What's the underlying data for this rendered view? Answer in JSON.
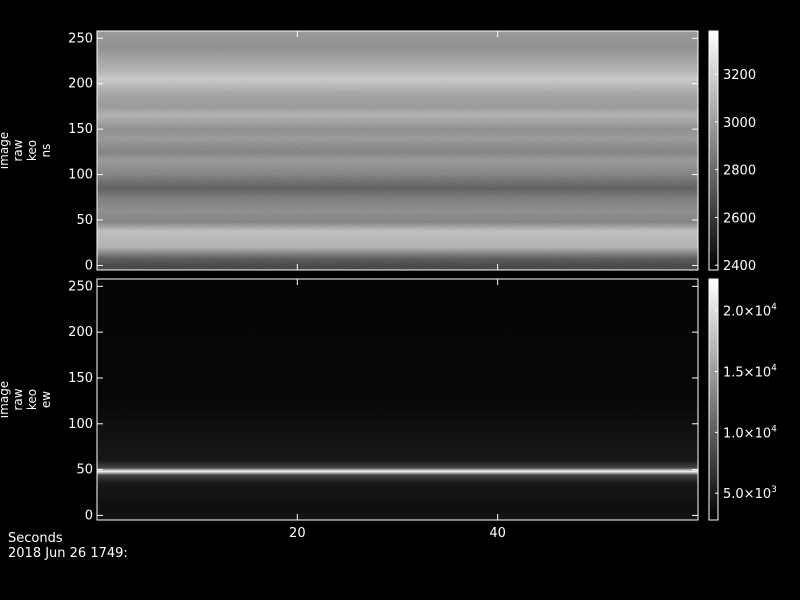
{
  "colors": {
    "background": "#000000",
    "foreground": "#ffffff"
  },
  "footer": {
    "xaxis_caption": "Seconds",
    "timestamp": "2018 Jun 26 1749:"
  },
  "chart_data": [
    {
      "type": "heatmap",
      "panel": "top",
      "ylabel_lines": [
        "image",
        "raw",
        "keo",
        "ns"
      ],
      "xlim": [
        0,
        60
      ],
      "ylim": [
        -5,
        258
      ],
      "x_ticks": [
        20,
        40
      ],
      "x_tick_labels": [],
      "y_ticks": [
        0,
        50,
        100,
        150,
        200,
        250
      ],
      "y_tick_labels": [
        "0",
        "50",
        "100",
        "150",
        "200",
        "250"
      ],
      "colormap": "grayscale",
      "colorbar": {
        "range": [
          2380,
          3380
        ],
        "ticks": [
          2400,
          2600,
          2800,
          3000,
          3200
        ],
        "tick_labels": [
          "2400",
          "2600",
          "2800",
          "3000",
          "3200"
        ]
      },
      "row_values": [
        {
          "y": 0,
          "value": 2600
        },
        {
          "y": 8,
          "value": 2700
        },
        {
          "y": 20,
          "value": 3050
        },
        {
          "y": 38,
          "value": 3100
        },
        {
          "y": 48,
          "value": 2850
        },
        {
          "y": 60,
          "value": 2900
        },
        {
          "y": 75,
          "value": 2820
        },
        {
          "y": 85,
          "value": 2700
        },
        {
          "y": 100,
          "value": 2850
        },
        {
          "y": 115,
          "value": 2950
        },
        {
          "y": 125,
          "value": 2850
        },
        {
          "y": 140,
          "value": 2950
        },
        {
          "y": 150,
          "value": 2900
        },
        {
          "y": 165,
          "value": 3050
        },
        {
          "y": 175,
          "value": 2950
        },
        {
          "y": 190,
          "value": 3000
        },
        {
          "y": 205,
          "value": 3150
        },
        {
          "y": 215,
          "value": 3050
        },
        {
          "y": 225,
          "value": 3000
        },
        {
          "y": 240,
          "value": 2900
        },
        {
          "y": 258,
          "value": 2950
        }
      ]
    },
    {
      "type": "heatmap",
      "panel": "bottom",
      "ylabel_lines": [
        "image",
        "raw",
        "keo",
        "ew"
      ],
      "xlim": [
        0,
        60
      ],
      "ylim": [
        -5,
        258
      ],
      "x_ticks": [
        20,
        40
      ],
      "x_tick_labels": [
        "20",
        "40"
      ],
      "y_ticks": [
        0,
        50,
        100,
        150,
        200,
        250
      ],
      "y_tick_labels": [
        "0",
        "50",
        "100",
        "150",
        "200",
        "250"
      ],
      "colormap": "grayscale",
      "colorbar": {
        "range": [
          2800,
          22600
        ],
        "ticks": [
          5000,
          10000,
          15000,
          20000
        ],
        "tick_labels": [
          {
            "mantissa": "5.0×10",
            "exponent": "3"
          },
          {
            "mantissa": "1.0×10",
            "exponent": "4"
          },
          {
            "mantissa": "1.5×10",
            "exponent": "4"
          },
          {
            "mantissa": "2.0×10",
            "exponent": "4"
          }
        ]
      },
      "row_values": [
        {
          "y": 0,
          "value": 4200
        },
        {
          "y": 10,
          "value": 3900
        },
        {
          "y": 20,
          "value": 4300
        },
        {
          "y": 35,
          "value": 4600
        },
        {
          "y": 44,
          "value": 8000
        },
        {
          "y": 48,
          "value": 22000
        },
        {
          "y": 52,
          "value": 8000
        },
        {
          "y": 60,
          "value": 4600
        },
        {
          "y": 80,
          "value": 4200
        },
        {
          "y": 100,
          "value": 4000
        },
        {
          "y": 115,
          "value": 3600
        },
        {
          "y": 130,
          "value": 3300
        },
        {
          "y": 258,
          "value": 3200
        }
      ]
    }
  ]
}
